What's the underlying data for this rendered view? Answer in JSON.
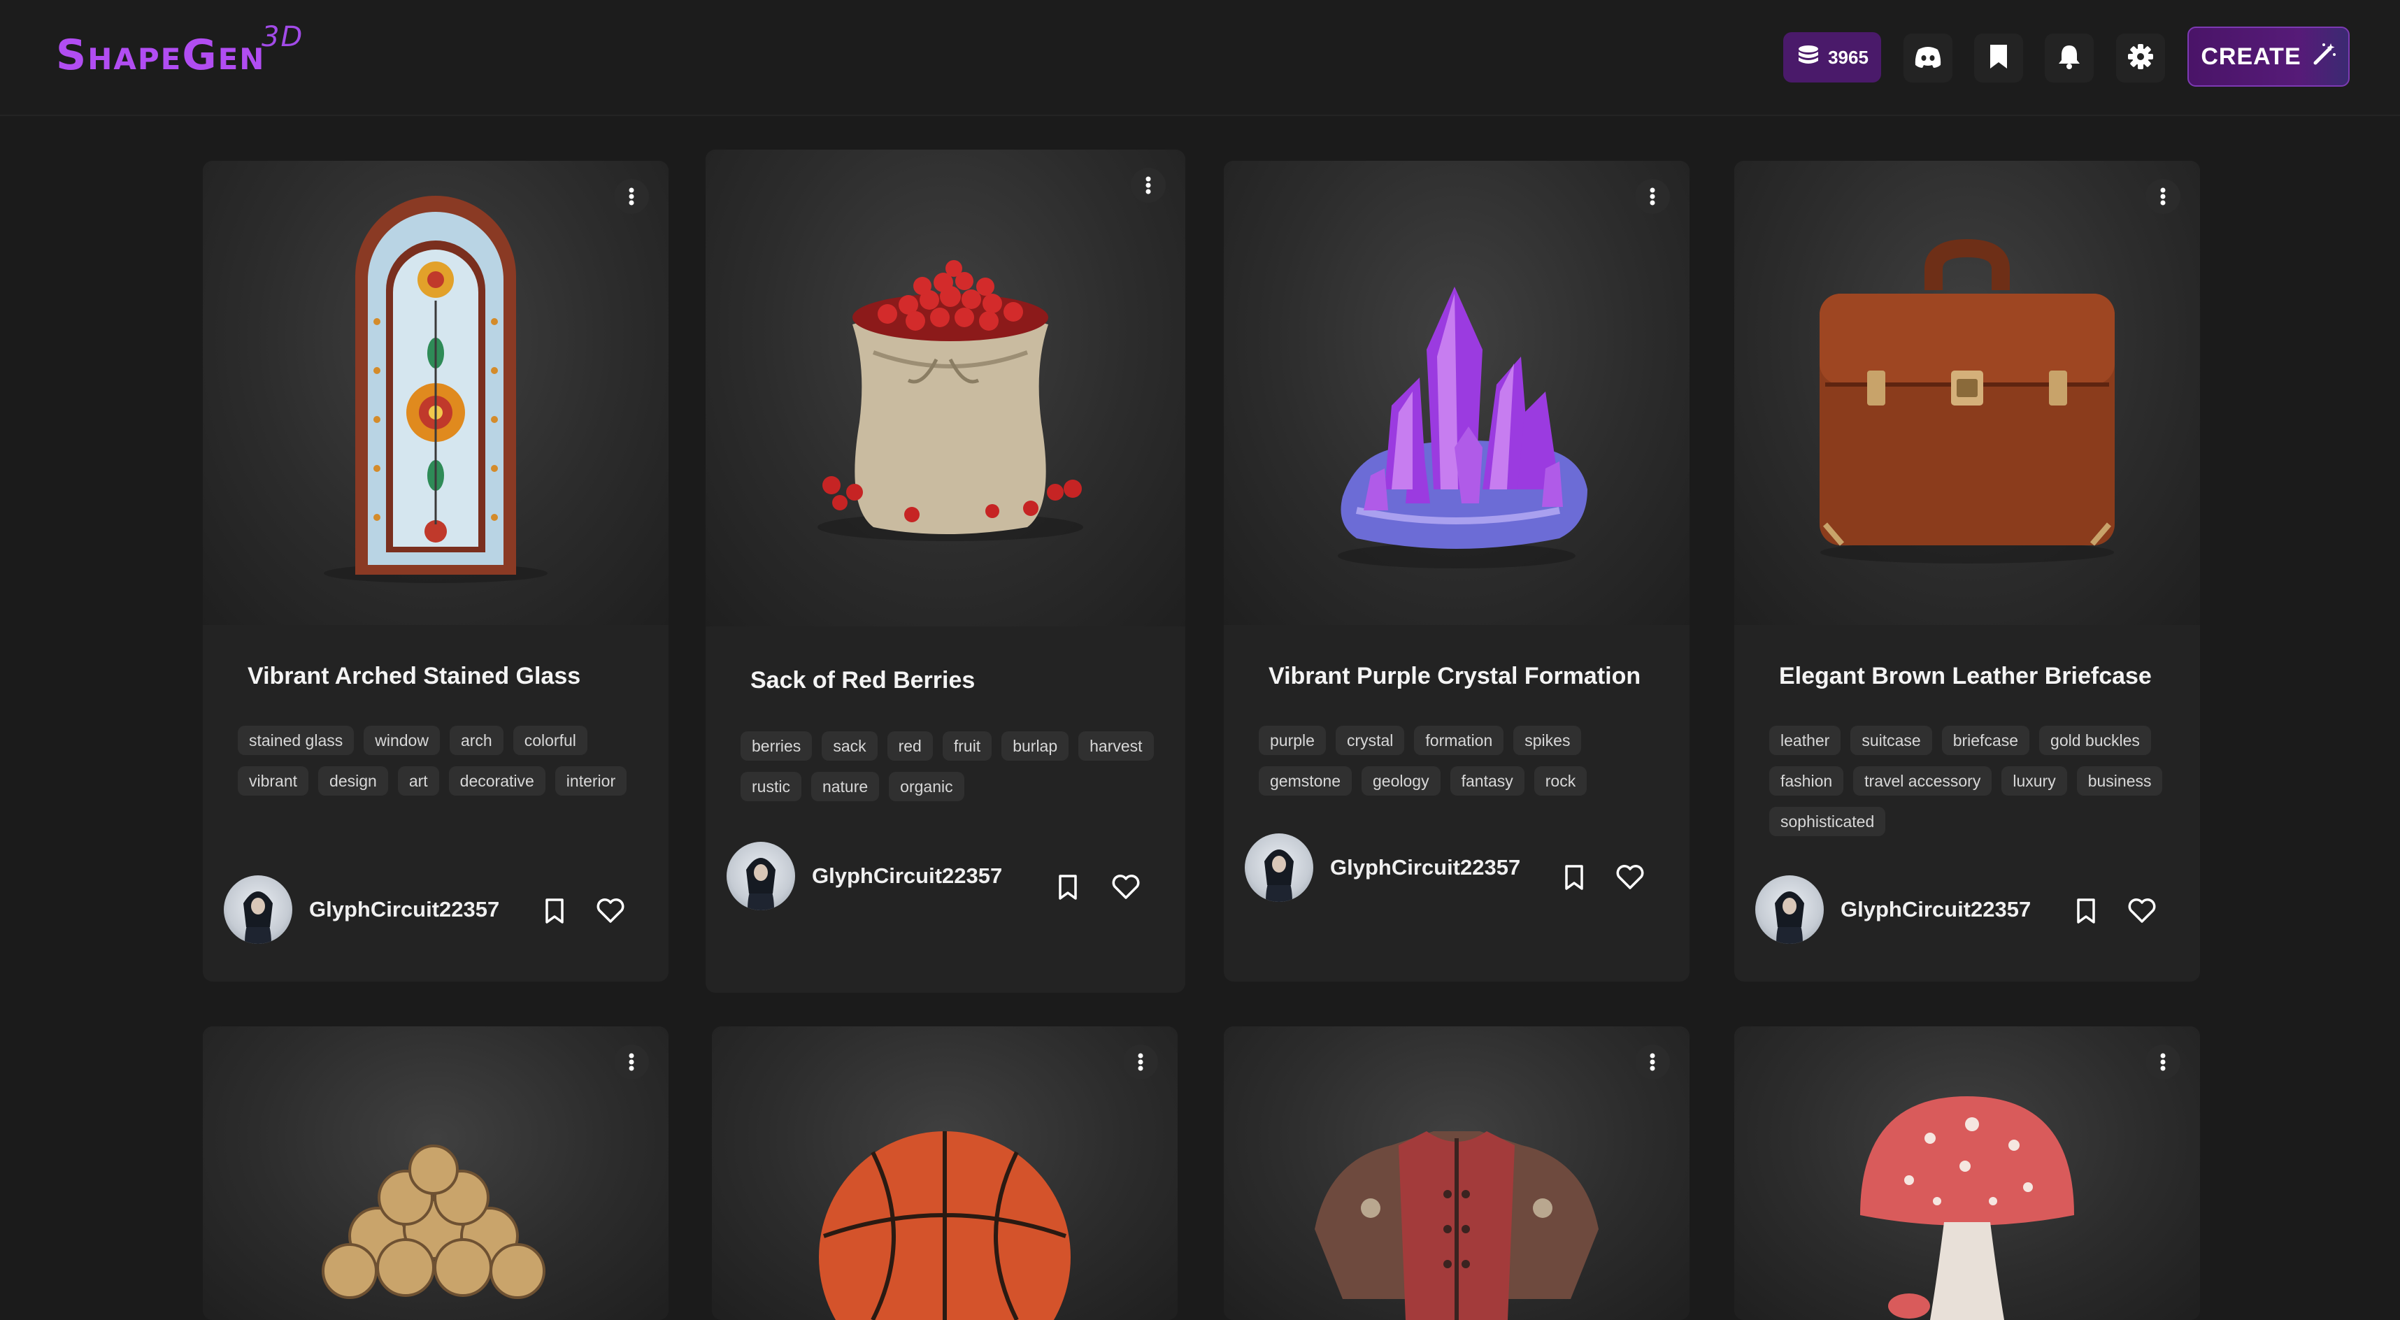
{
  "app": {
    "logo_main": "ShapeGen",
    "logo_sup": "3D"
  },
  "header": {
    "credits": "3965",
    "create_label": "CREATE",
    "icons": [
      "coins-icon",
      "discord-icon",
      "bookmark-icon",
      "bell-icon",
      "gear-icon",
      "magic-wand-icon"
    ]
  },
  "colors": {
    "accent": "#b14df2",
    "create_bg": "#4a1468",
    "card_bg": "#232323",
    "page_bg": "#1b1b1b"
  },
  "cards": [
    {
      "title": "Vibrant Arched Stained Glass",
      "tags": [
        "stained glass",
        "window",
        "arch",
        "colorful",
        "vibrant",
        "design",
        "art",
        "decorative",
        "interior"
      ],
      "author": "GlyphCircuit22357"
    },
    {
      "title": "Sack of Red Berries",
      "tags": [
        "berries",
        "sack",
        "red",
        "fruit",
        "burlap",
        "harvest",
        "rustic",
        "nature",
        "organic"
      ],
      "author": "GlyphCircuit22357"
    },
    {
      "title": "Vibrant Purple Crystal Formation",
      "tags": [
        "purple",
        "crystal",
        "formation",
        "spikes",
        "gemstone",
        "geology",
        "fantasy",
        "rock"
      ],
      "author": "GlyphCircuit22357"
    },
    {
      "title": "Elegant Brown Leather Briefcase",
      "tags": [
        "leather",
        "suitcase",
        "briefcase",
        "gold buckles",
        "fashion",
        "travel accessory",
        "luxury",
        "business",
        "sophisticated"
      ],
      "author": "GlyphCircuit22357"
    }
  ],
  "bottom_row": [
    "firewood-stack",
    "basketball",
    "leather-armor",
    "red-mushroom"
  ]
}
